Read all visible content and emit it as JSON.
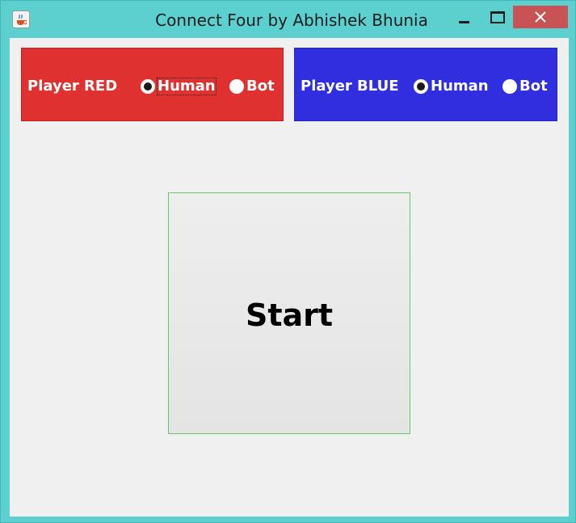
{
  "window": {
    "title": "Connect Four by Abhishek Bhunia",
    "icon": "java-coffee-icon",
    "controls": [
      "minimize-icon",
      "maximize-icon",
      "close-icon"
    ]
  },
  "players": [
    {
      "label": "Player RED",
      "color": "#e03131",
      "options": [
        {
          "label": "Human",
          "selected": true
        },
        {
          "label": "Bot",
          "selected": false
        }
      ]
    },
    {
      "label": "Player BLUE",
      "color": "#2f2fe0",
      "options": [
        {
          "label": "Human",
          "selected": true
        },
        {
          "label": "Bot",
          "selected": false
        }
      ]
    }
  ],
  "start_button": {
    "label": "Start"
  }
}
